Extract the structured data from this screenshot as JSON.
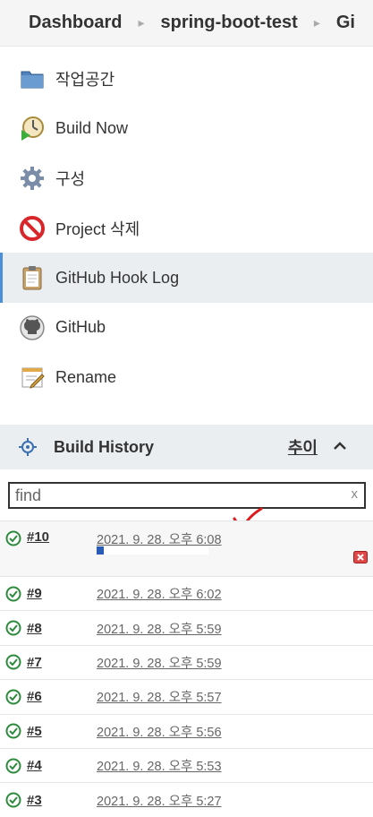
{
  "breadcrumb": {
    "items": [
      "Dashboard",
      "spring-boot-test",
      "Gi"
    ]
  },
  "nav": {
    "items": [
      {
        "label": "작업공간",
        "icon": "folder-icon"
      },
      {
        "label": "Build Now",
        "icon": "build-now-icon"
      },
      {
        "label": "구성",
        "icon": "gear-icon"
      },
      {
        "label": "Project 삭제",
        "icon": "no-entry-icon"
      },
      {
        "label": "GitHub Hook Log",
        "icon": "clipboard-icon",
        "active": true
      },
      {
        "label": "GitHub",
        "icon": "github-icon"
      },
      {
        "label": "Rename",
        "icon": "rename-icon"
      }
    ]
  },
  "build_history": {
    "title": "Build History",
    "trend_label": "추이",
    "search": {
      "value": "",
      "placeholder": "find",
      "clear_label": "x"
    },
    "builds": [
      {
        "number": "#10",
        "date": "2021. 9. 28. 오후 6:08",
        "running": true,
        "progress": 0.06
      },
      {
        "number": "#9",
        "date": "2021. 9. 28. 오후 6:02"
      },
      {
        "number": "#8",
        "date": "2021. 9. 28. 오후 5:59"
      },
      {
        "number": "#7",
        "date": "2021. 9. 28. 오후 5:59"
      },
      {
        "number": "#6",
        "date": "2021. 9. 28. 오후 5:57"
      },
      {
        "number": "#5",
        "date": "2021. 9. 28. 오후 5:56"
      },
      {
        "number": "#4",
        "date": "2021. 9. 28. 오후 5:53"
      },
      {
        "number": "#3",
        "date": "2021. 9. 28. 오후 5:27"
      }
    ]
  },
  "colors": {
    "success": "#2e8b3d",
    "accent": "#4a90d9",
    "progress": "#2a5bb7",
    "annotation": "#e0191c"
  }
}
